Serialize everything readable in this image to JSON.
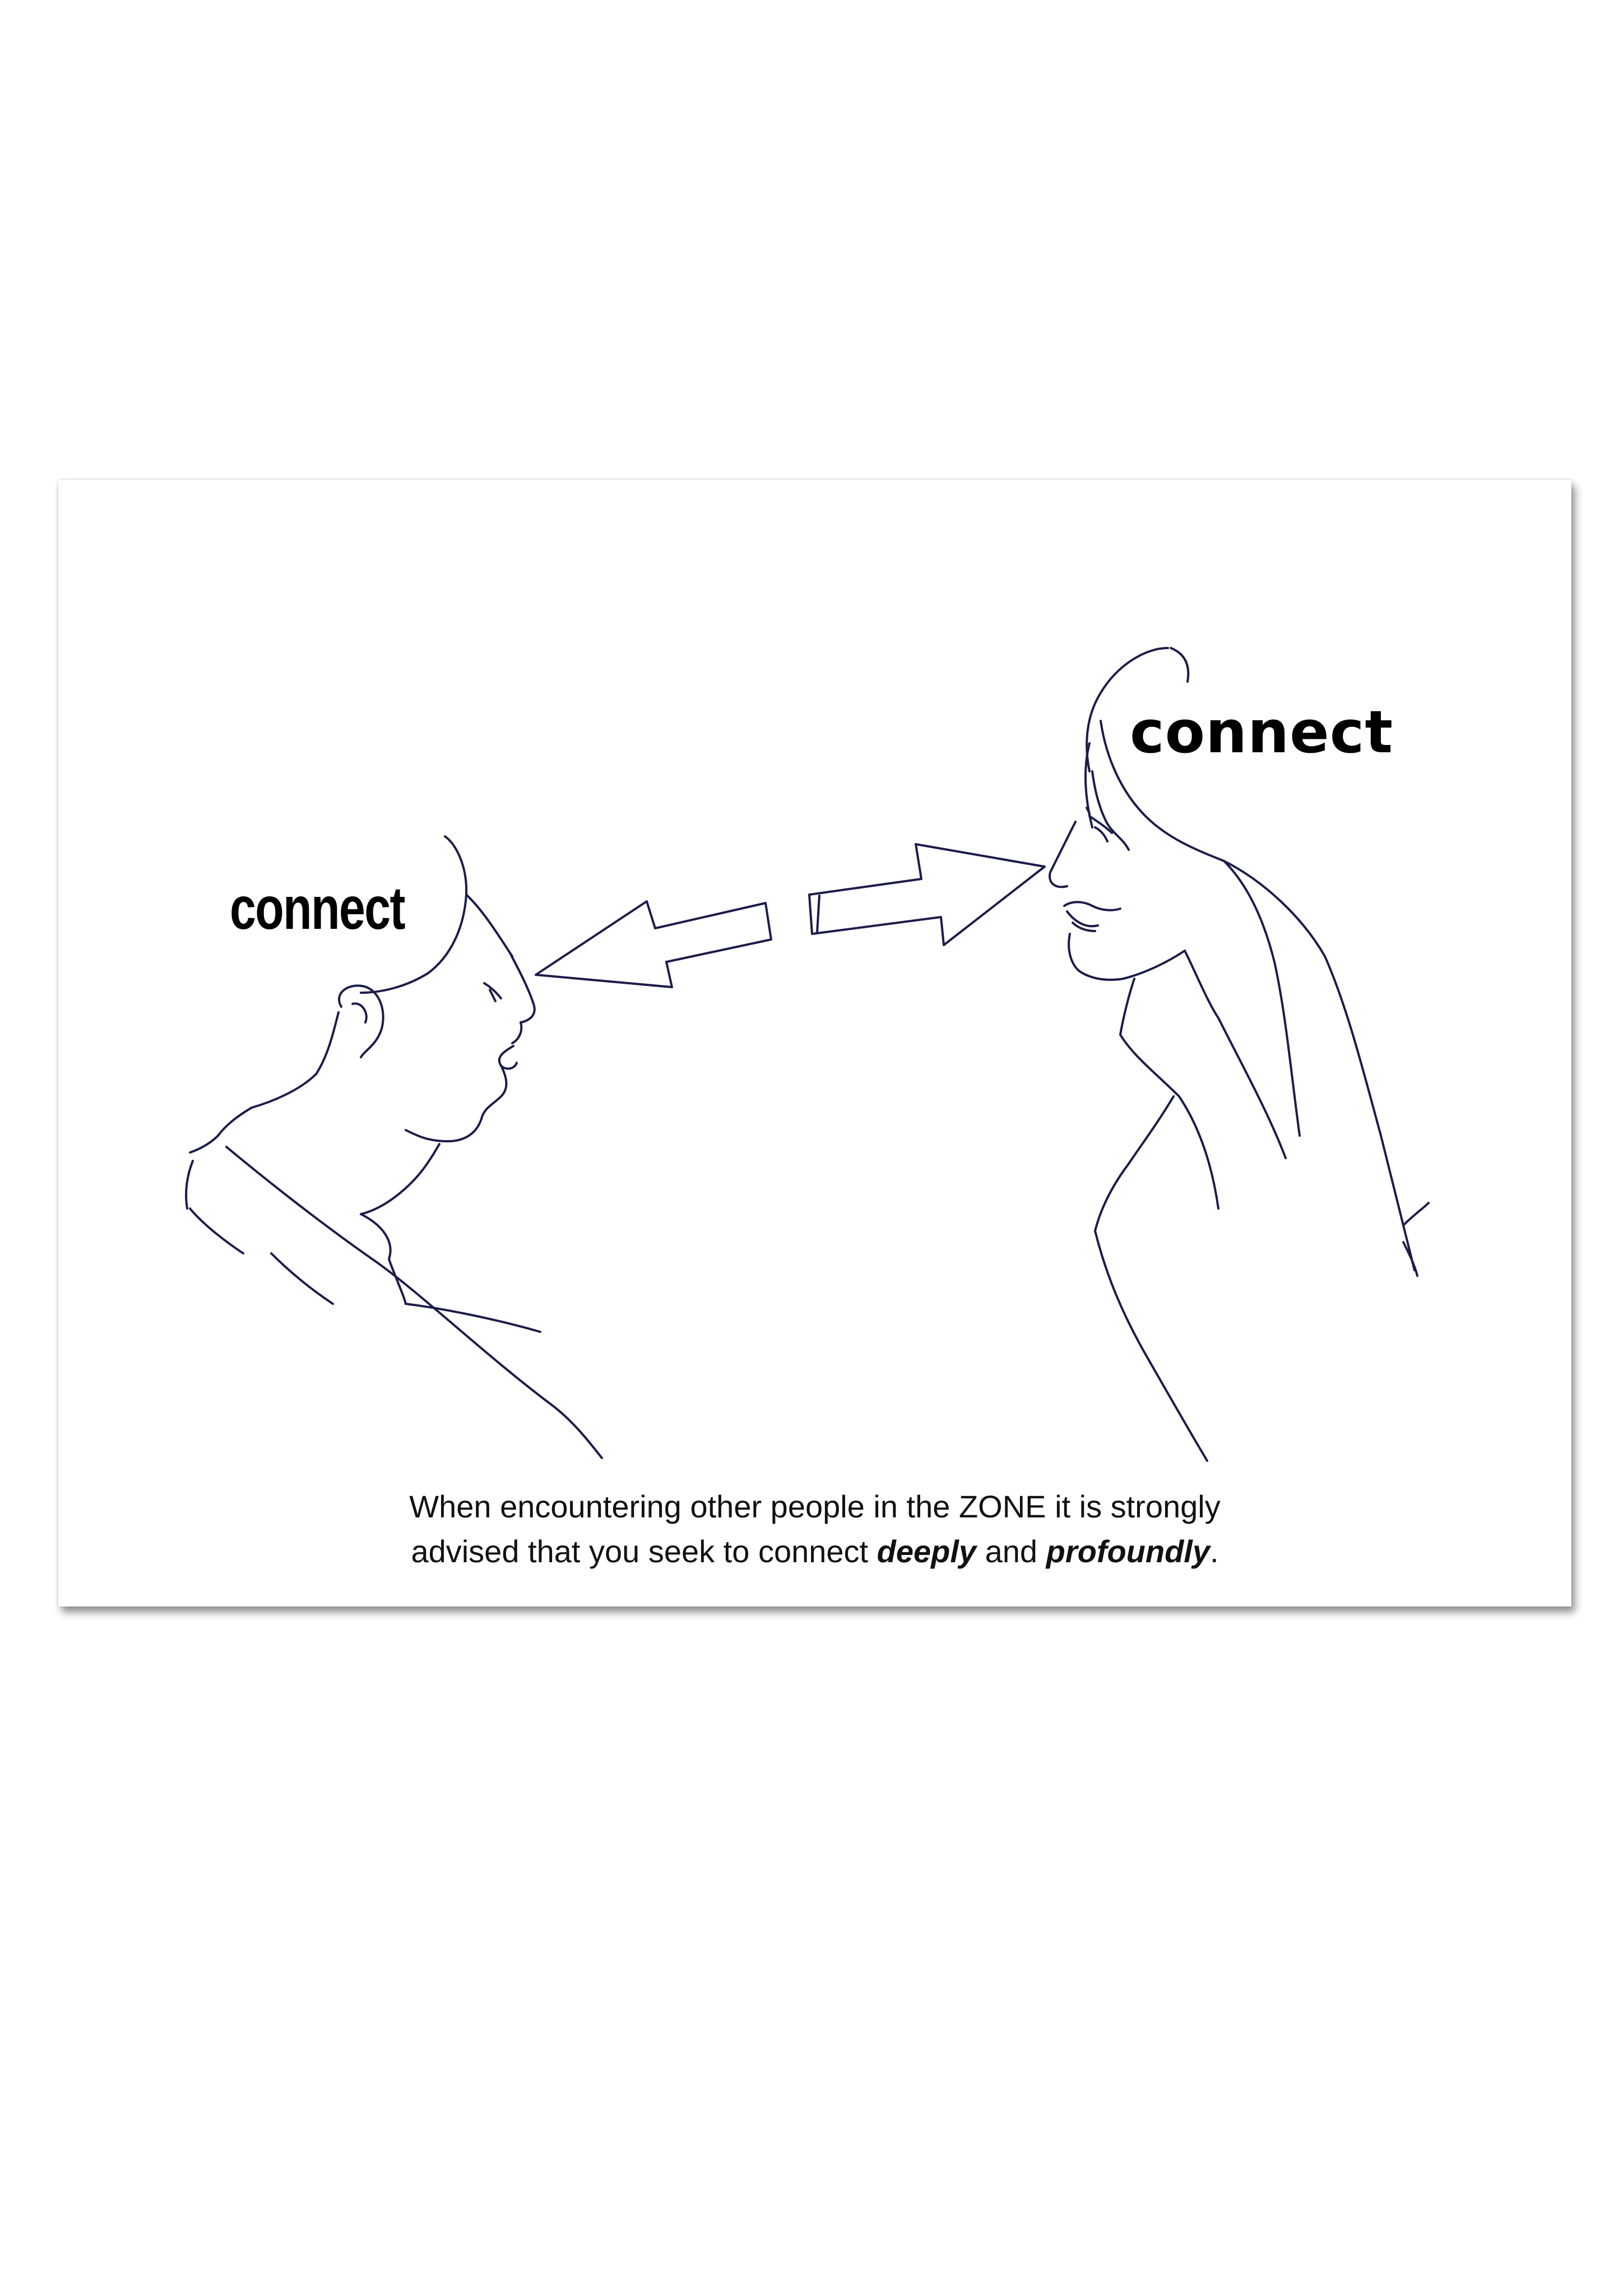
{
  "labels": {
    "left": "connect",
    "right": "connect"
  },
  "caption": {
    "line1": "When encountering other people in the ZONE it is strongly",
    "line2_prefix": "advised that you seek to connect ",
    "emphasis1": "deeply",
    "joiner": " and ",
    "emphasis2": "profoundly",
    "suffix": "."
  },
  "colors": {
    "ink": "#1c1c4a",
    "text": "#000000"
  }
}
